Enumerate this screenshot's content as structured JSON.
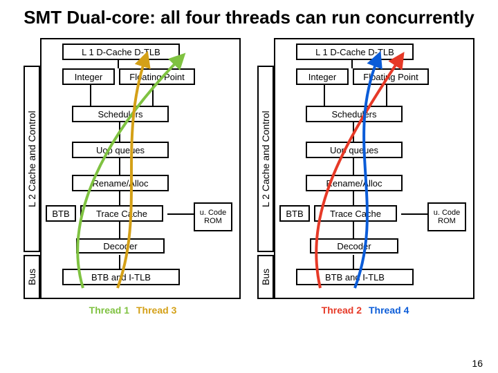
{
  "title": "SMT Dual-core: all four threads can run concurrently",
  "page_number": "16",
  "sidebar": {
    "l2_label": "L 2 Cache and Control",
    "bus_label": "Bus"
  },
  "blocks": {
    "top": "L 1 D-Cache D-TLB",
    "int": "Integer",
    "fp": "Floating Point",
    "sched": "Schedulers",
    "q": "Uop queues",
    "ren": "Rename/Alloc",
    "btb": "BTB",
    "trace": "Trace Cache",
    "ucode": "u. Code ROM",
    "dec": "Decoder",
    "itlb": "BTB and I-TLB"
  },
  "threads": {
    "t1": "Thread 1",
    "t2": "Thread 2",
    "t3": "Thread 3",
    "t4": "Thread 4"
  },
  "colors": {
    "t1": "#7fc241",
    "t2": "#e63927",
    "t3": "#d4a017",
    "t4": "#0b5cd8"
  }
}
